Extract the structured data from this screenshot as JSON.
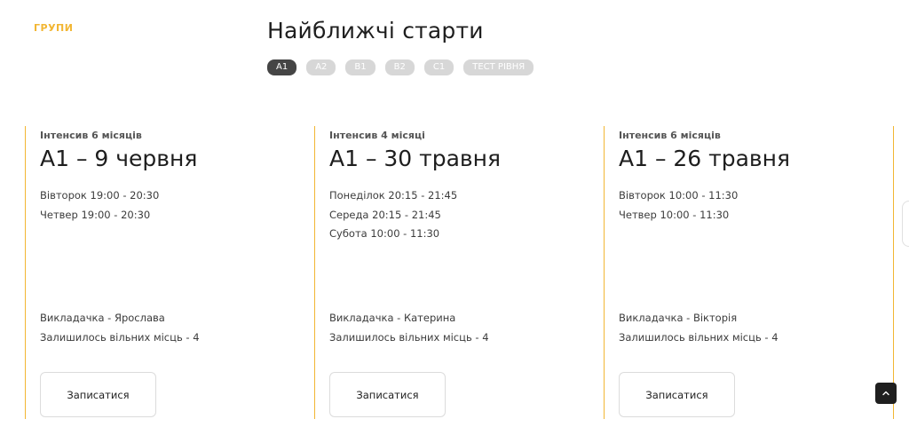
{
  "section_label": "ГРУПИ",
  "heading": "Найближчі старти",
  "tabs": [
    {
      "label": "A1",
      "active": true
    },
    {
      "label": "A2",
      "active": false
    },
    {
      "label": "B1",
      "active": false
    },
    {
      "label": "B2",
      "active": false
    },
    {
      "label": "C1",
      "active": false
    },
    {
      "label": "ТЕСТ РІВНЯ",
      "active": false
    }
  ],
  "cards": [
    {
      "type": "Інтенсив 6 місяців",
      "title": "A1 – 9 червня",
      "schedule": [
        "Вівторок 19:00 - 20:30",
        "Четвер 19:00 - 20:30"
      ],
      "teacher": "Викладачка - Ярослава",
      "seats": "Залишилось вільних місць - 4",
      "button": "Записатися"
    },
    {
      "type": "Інтенсив 4 місяці",
      "title": "A1 – 30 травня",
      "schedule": [
        "Понеділок 20:15 - 21:45",
        "Середа 20:15 - 21:45",
        "Субота 10:00 - 11:30"
      ],
      "teacher": "Викладачка - Катерина",
      "seats": "Залишилось вільних місць - 4",
      "button": "Записатися"
    },
    {
      "type": "Інтенсив 6 місяців",
      "title": "A1 – 26 травня",
      "schedule": [
        "Вівторок 10:00 - 11:30",
        "Четвер 10:00 - 11:30"
      ],
      "teacher": "Викладачка - Вікторія",
      "seats": "Залишилось вільних місць - 4",
      "button": "Записатися"
    }
  ],
  "colors": {
    "accent": "#f2b633",
    "tab_active": "#454545",
    "tab_inactive": "#d7d7d7"
  },
  "icons": {
    "scroll_top": "chevron-up-icon"
  }
}
